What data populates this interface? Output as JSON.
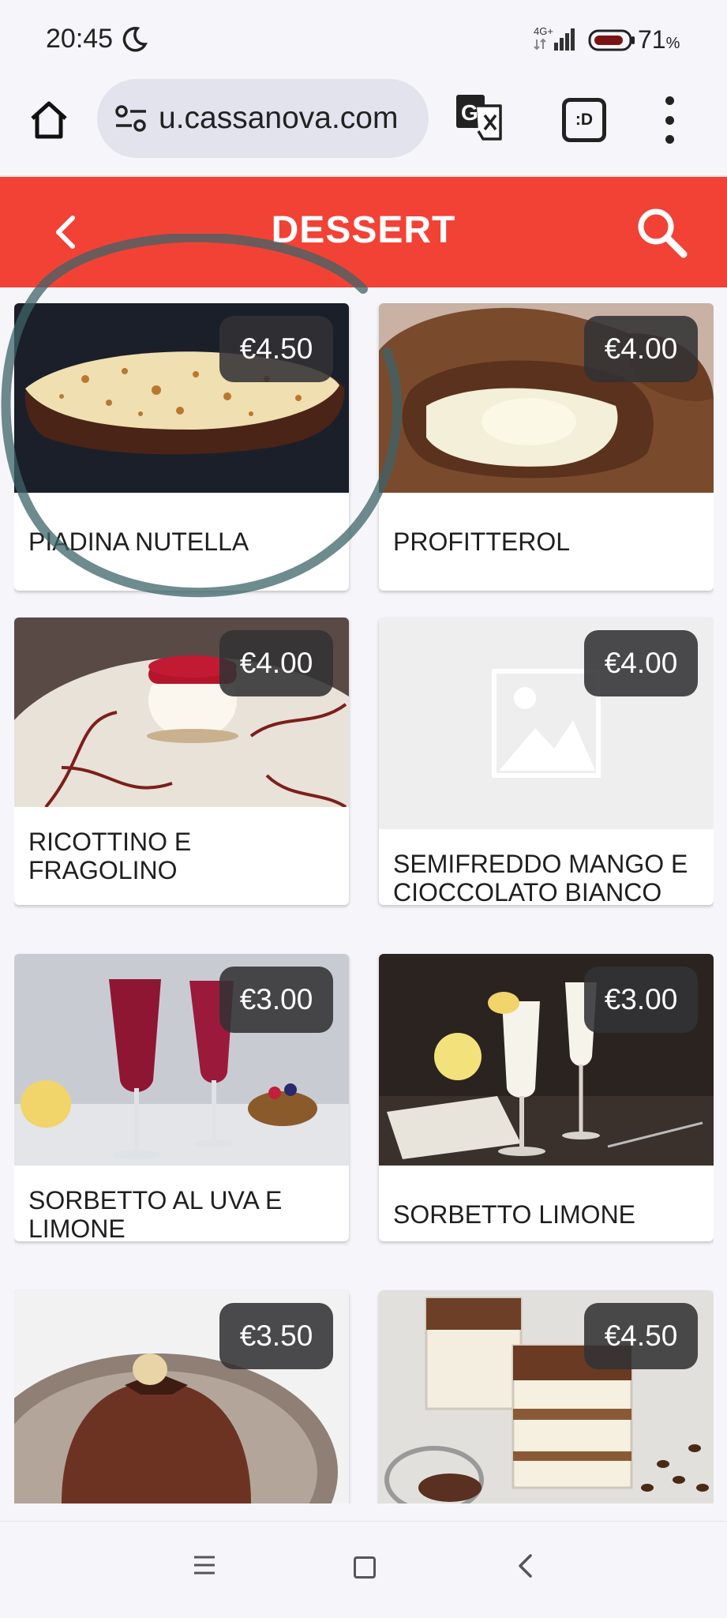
{
  "status_bar": {
    "time": "20:45",
    "network": "4G+",
    "battery_percent": "71",
    "battery_unit": "%",
    "icons": [
      "moon-icon",
      "signal-icon",
      "battery-icon"
    ]
  },
  "browser": {
    "url": "u.cassanova.com",
    "tab_label": ":D",
    "icons": [
      "home-icon",
      "site-settings-icon",
      "translate-icon",
      "tab-switcher-icon",
      "more-vert-icon"
    ]
  },
  "header": {
    "title": "DESSERT",
    "background_color": "#f24236",
    "icons": [
      "back-chevron-icon",
      "search-icon"
    ]
  },
  "products": [
    {
      "name": "PIADINA NUTELLA",
      "price": "€4.50"
    },
    {
      "name": "PROFITTEROL",
      "price": "€4.00"
    },
    {
      "name": "RICOTTINO E FRAGOLINO",
      "price": "€4.00"
    },
    {
      "name": "SEMIFREDDO MANGO E CIOCCOLATO BIANCO",
      "price": "€4.00"
    },
    {
      "name": "SORBETTO AL UVA E LIMONE",
      "price": "€3.00"
    },
    {
      "name": "SORBETTO LIMONE",
      "price": "€3.00"
    },
    {
      "name": "",
      "price": "€3.50"
    },
    {
      "name": "",
      "price": "€4.50"
    }
  ],
  "system_nav": {
    "icons": [
      "menu-lines-icon",
      "home-square-icon",
      "back-chevron-icon"
    ]
  }
}
